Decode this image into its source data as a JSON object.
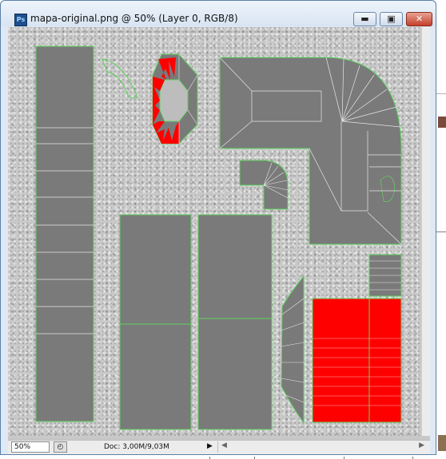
{
  "window": {
    "title": "mapa-original.png @ 50% (Layer 0, RGB/8)",
    "app_icon_text": "Ps",
    "controls": {
      "minimize": "▬",
      "maximize": "▣",
      "close": "✕"
    }
  },
  "status": {
    "zoom": "50%",
    "doc_info": "Doc: 3,00M/9,03M",
    "menu_arrow": "▶",
    "scroll_left": "◀",
    "scroll_right": "▶"
  },
  "colors": {
    "face_fill": "#7a7a7a",
    "face_red": "#ff0000",
    "edge_green": "#5fd35f",
    "edge_white": "#e6e6e6"
  }
}
